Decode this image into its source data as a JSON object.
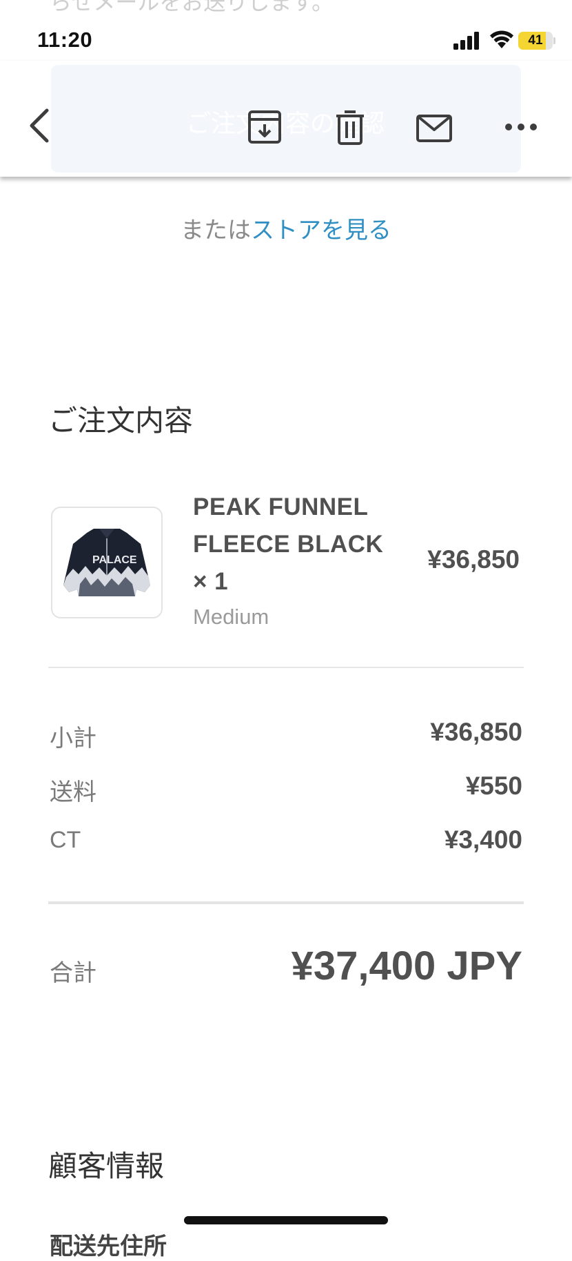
{
  "email_background": {
    "faded_text": "らせメールをお送りします。"
  },
  "status_bar": {
    "time": "11:20",
    "battery": "41",
    "battery_level": 0.41
  },
  "toolbar": {
    "faded_title": "ご注文内容の確認"
  },
  "store": {
    "prefix": "または",
    "link": "ストアを見る"
  },
  "order": {
    "title": "ご注文内容",
    "items": [
      {
        "name": "PEAK FUNNEL FLEECE BLACK × 1",
        "variant": "Medium",
        "price": "¥36,850"
      }
    ]
  },
  "summary": {
    "rows": [
      {
        "label": "小計",
        "value": "¥36,850"
      },
      {
        "label": "送料",
        "value": "¥550"
      },
      {
        "label": "CT",
        "value": "¥3,400"
      }
    ],
    "total_label": "合計",
    "total_value": "¥37,400 JPY"
  },
  "customer": {
    "title": "顧客情報",
    "next_heading": "配送先住所"
  },
  "colors": {
    "link": "#2f8fc4",
    "battery": "#f4d531",
    "text": "#505050"
  }
}
